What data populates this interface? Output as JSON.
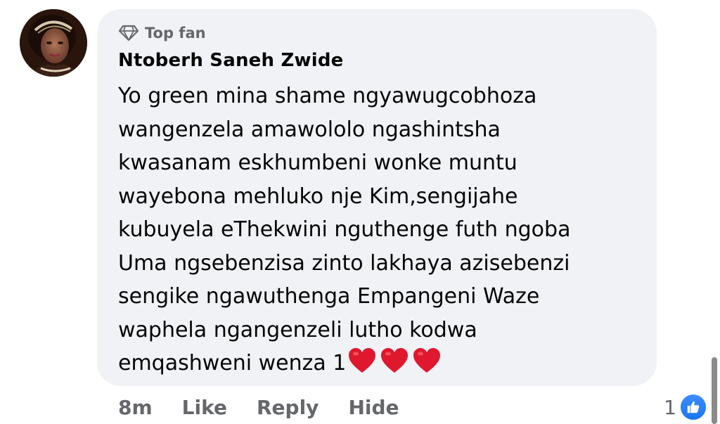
{
  "comment": {
    "badge_label": "Top fan",
    "author": "Ntoberh Saneh Zwide",
    "lines": [
      "Yo green mina shame ngyawugcobhoza",
      "wangenzela amawololo ngashintsha",
      "kwasanam eskhumbeni wonke muntu",
      "wayebona mehluko nje Kim,sengijahe",
      "kubuyela eThekwini nguthenge futh ngoba",
      "Uma ngsebenzisa zinto lakhaya azisebenzi",
      "sengike ngawuthenga Empangeni Waze",
      "waphela ngangenzeli lutho kodwa",
      "emqashweni wenza 1"
    ],
    "trailing_emoji": [
      "heart-icon",
      "heart-icon",
      "heart-icon"
    ]
  },
  "actions": {
    "time": "8m",
    "like_label": "Like",
    "reply_label": "Reply",
    "hide_label": "Hide"
  },
  "reactions": {
    "count": "1",
    "icon": "thumbs-up-icon"
  },
  "colors": {
    "bubble_bg": "#f0f2f5",
    "secondary_text": "#65676b",
    "primary_text": "#050505",
    "like_blue": "#1877f2",
    "heart_red": "#e0182d"
  }
}
